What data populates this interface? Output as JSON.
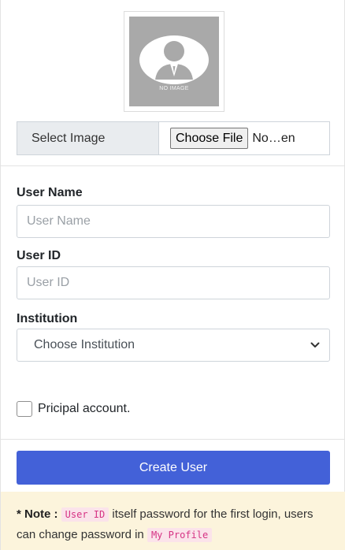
{
  "avatar": {
    "placeholder_text": "NO IMAGE"
  },
  "image_select": {
    "label": "Select Image",
    "button_label": "Choose File",
    "file_status": "No…en"
  },
  "form": {
    "user_name": {
      "label": "User Name",
      "placeholder": "User Name"
    },
    "user_id": {
      "label": "User ID",
      "placeholder": "User ID"
    },
    "institution": {
      "label": "Institution",
      "selected": "Choose Institution"
    },
    "principal_checkbox": {
      "label": "Pricipal account."
    },
    "submit_label": "Create User"
  },
  "note": {
    "prefix": "* Note :",
    "code_user_id": "User ID",
    "text_1": "itself password for the first login, users can change password in",
    "code_my_profile": "My Profile"
  },
  "colors": {
    "primary_button": "#4361d8",
    "note_background": "#fcf4dc",
    "code_text": "#d63384"
  }
}
